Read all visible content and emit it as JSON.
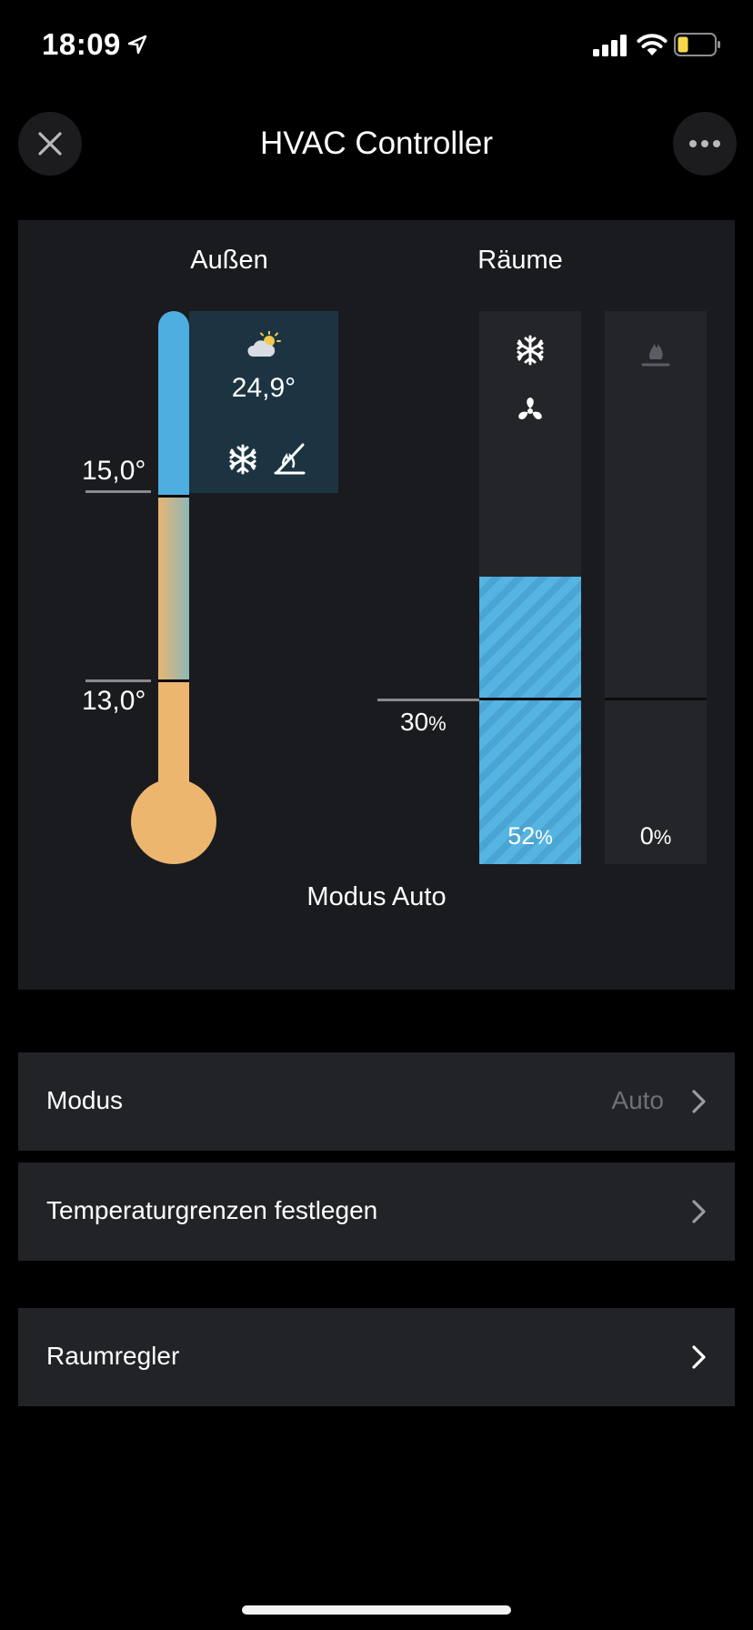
{
  "status_bar": {
    "time": "18:09"
  },
  "nav": {
    "title": "HVAC Controller"
  },
  "panel": {
    "outside_title": "Außen",
    "rooms_title": "Räume",
    "weather_temp": "24,9°",
    "upper_limit": "15,0°",
    "lower_limit": "13,0°",
    "threshold_value": "30",
    "cooling_percent": "52",
    "heating_percent": "0",
    "percent_unit": "%",
    "cooling_level": 0.52,
    "heating_level": 0.0,
    "mode_status": "Modus Auto"
  },
  "rows": {
    "mode_label": "Modus",
    "mode_value": "Auto",
    "temp_limits_label": "Temperaturgrenzen festlegen",
    "room_controller_label": "Raumregler"
  },
  "colors": {
    "cool_blue": "#56b4e2",
    "warm_orange": "#edb66f",
    "weather_card": "#1c3442",
    "background": "#000000"
  },
  "icons": [
    "location-arrow-icon",
    "signal-icon",
    "wifi-icon",
    "battery-icon",
    "close-icon",
    "more-icon",
    "partly-sunny-icon",
    "snowflake-icon",
    "fan-icon",
    "flame-icon",
    "heating-off-icon",
    "chevron-right-icon"
  ]
}
